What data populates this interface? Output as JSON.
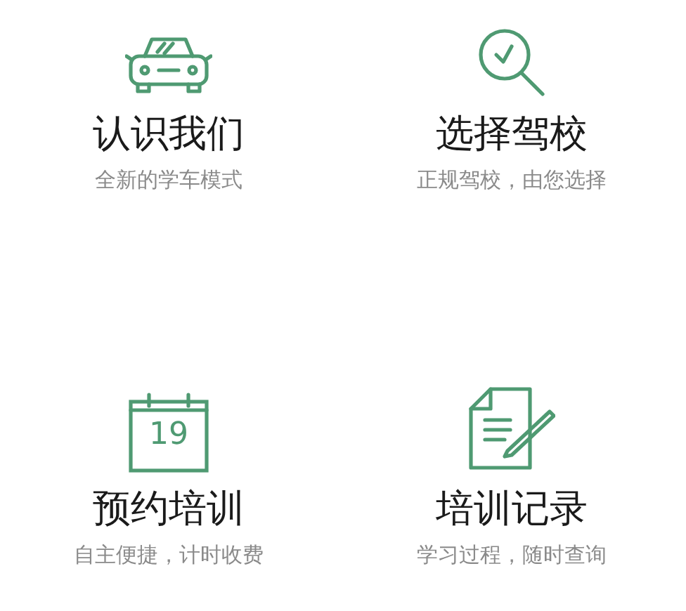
{
  "features": [
    {
      "kind": "car",
      "title": "认识我们",
      "subtitle": "全新的学车模式"
    },
    {
      "kind": "search",
      "title": "选择驾校",
      "subtitle": "正规驾校，由您选择"
    },
    {
      "kind": "calendar",
      "day": "19",
      "title": "预约培训",
      "subtitle": "自主便捷，计时收费"
    },
    {
      "kind": "document",
      "title": "培训记录",
      "subtitle": "学习过程，随时查询"
    }
  ]
}
